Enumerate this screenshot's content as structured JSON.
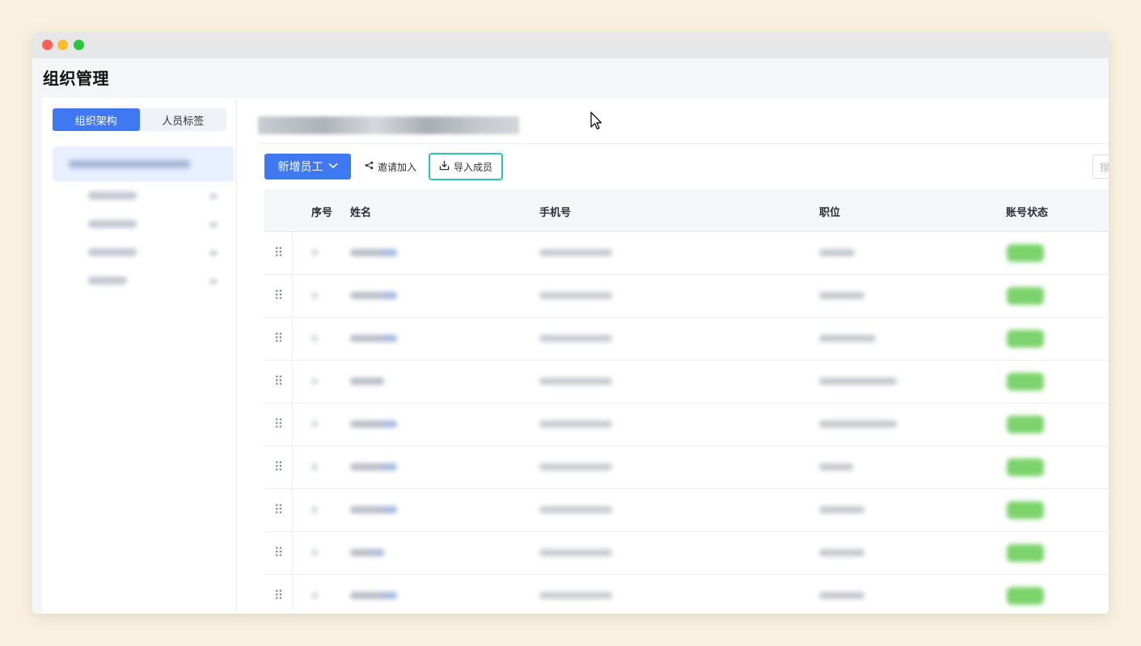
{
  "page": {
    "title": "组织管理"
  },
  "sidebar": {
    "tabs": [
      {
        "label": "组织架构",
        "active": true
      },
      {
        "label": "人员标签",
        "active": false
      }
    ],
    "tree_row_count": 5
  },
  "toolbar": {
    "add_employee_label": "新增员工",
    "add_employee_caret": "chevron-down-icon",
    "invite_label": "邀请加入",
    "import_label": "导入成员",
    "search_placeholder": "搜"
  },
  "table": {
    "columns": {
      "index": "序号",
      "name": "姓名",
      "phone": "手机号",
      "position": "职位",
      "status": "账号状态"
    },
    "row_count": 9
  },
  "colors": {
    "primary": "#3f78f0",
    "highlight_border": "#2bc6b2",
    "status_green": "#7cd36c"
  }
}
